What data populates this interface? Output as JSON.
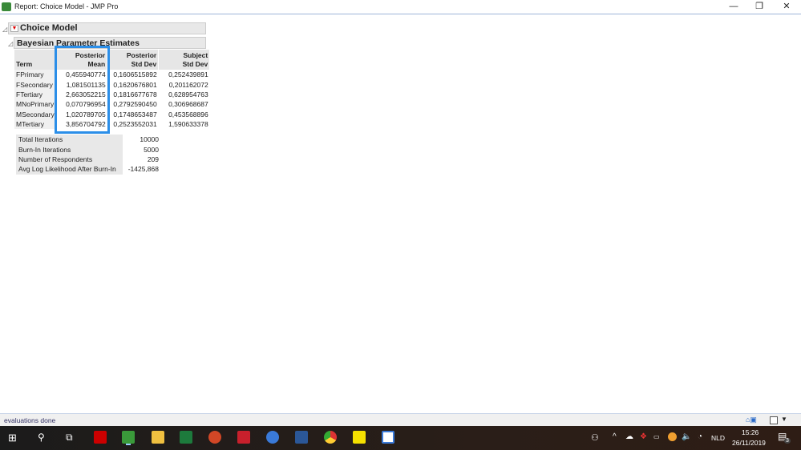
{
  "window": {
    "title": "Report: Choice Model - JMP Pro",
    "minimize": "—",
    "restore": "❐",
    "close": "✕"
  },
  "report": {
    "title": "Choice Model",
    "section": "Bayesian Parameter Estimates",
    "columns": [
      [
        "Term",
        ""
      ],
      [
        "Posterior",
        "Mean"
      ],
      [
        "Posterior",
        "Std Dev"
      ],
      [
        "Subject",
        "Std Dev"
      ]
    ],
    "rows": [
      [
        "FPrimary",
        "0,455940774",
        "0,1606515892",
        "0,252439891"
      ],
      [
        "FSecondary",
        "1,081501135",
        "0,1620676801",
        "0,201162072"
      ],
      [
        "FTertiary",
        "2,663052215",
        "0,1816677678",
        "0,628954763"
      ],
      [
        "MNoPrimary",
        "0,070796954",
        "0,2792590450",
        "0,306968687"
      ],
      [
        "MSecondary",
        "1,020789705",
        "0,1748653487",
        "0,453568896"
      ],
      [
        "MTertiary",
        "3,856704792",
        "0,2523552031",
        "1,590633378"
      ]
    ],
    "summary": [
      [
        "Total Iterations",
        "10000"
      ],
      [
        "Burn-In Iterations",
        "5000"
      ],
      [
        "Number of Respondents",
        "209"
      ],
      [
        "Avg Log Likelihood After Burn-In",
        "-1425,868"
      ]
    ]
  },
  "status": {
    "message": "evaluations done"
  },
  "tray": {
    "language": "NLD",
    "time": "15:26",
    "date": "26/11/2019",
    "notifications": "3"
  },
  "colors": {
    "highlight": "#2b8ee8"
  }
}
